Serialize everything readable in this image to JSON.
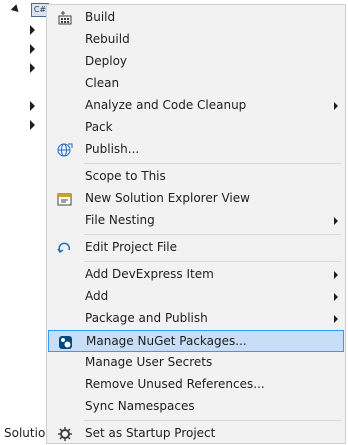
{
  "background": {
    "project_badge": "C#",
    "bottom_label": "Solution"
  },
  "menu": {
    "items": [
      {
        "label": "Build",
        "icon": "build-icon",
        "submenu": false
      },
      {
        "label": "Rebuild",
        "submenu": false
      },
      {
        "label": "Deploy",
        "submenu": false
      },
      {
        "label": "Clean",
        "submenu": false
      },
      {
        "label": "Analyze and Code Cleanup",
        "submenu": true
      },
      {
        "label": "Pack",
        "submenu": false
      },
      {
        "label": "Publish...",
        "icon": "globe-publish-icon",
        "submenu": false
      },
      {
        "label": "Scope to This",
        "submenu": false
      },
      {
        "label": "New Solution Explorer View",
        "icon": "new-view-icon",
        "submenu": false
      },
      {
        "label": "File Nesting",
        "submenu": true
      },
      {
        "label": "Edit Project File",
        "icon": "edit-arrow-icon",
        "submenu": false
      },
      {
        "label": "Add DevExpress Item",
        "submenu": true
      },
      {
        "label": "Add",
        "submenu": true
      },
      {
        "label": "Package and Publish",
        "submenu": true
      },
      {
        "label": "Manage NuGet Packages...",
        "icon": "nuget-icon",
        "submenu": false,
        "highlighted": true
      },
      {
        "label": "Manage User Secrets",
        "submenu": false
      },
      {
        "label": "Remove Unused References...",
        "submenu": false
      },
      {
        "label": "Sync Namespaces",
        "submenu": false
      },
      {
        "label": "Set as Startup Project",
        "icon": "gear-icon",
        "submenu": false
      }
    ]
  },
  "colors": {
    "menu_bg": "#f2f2f2",
    "highlight_bg": "#c9def5",
    "highlight_border": "#3399ff"
  }
}
